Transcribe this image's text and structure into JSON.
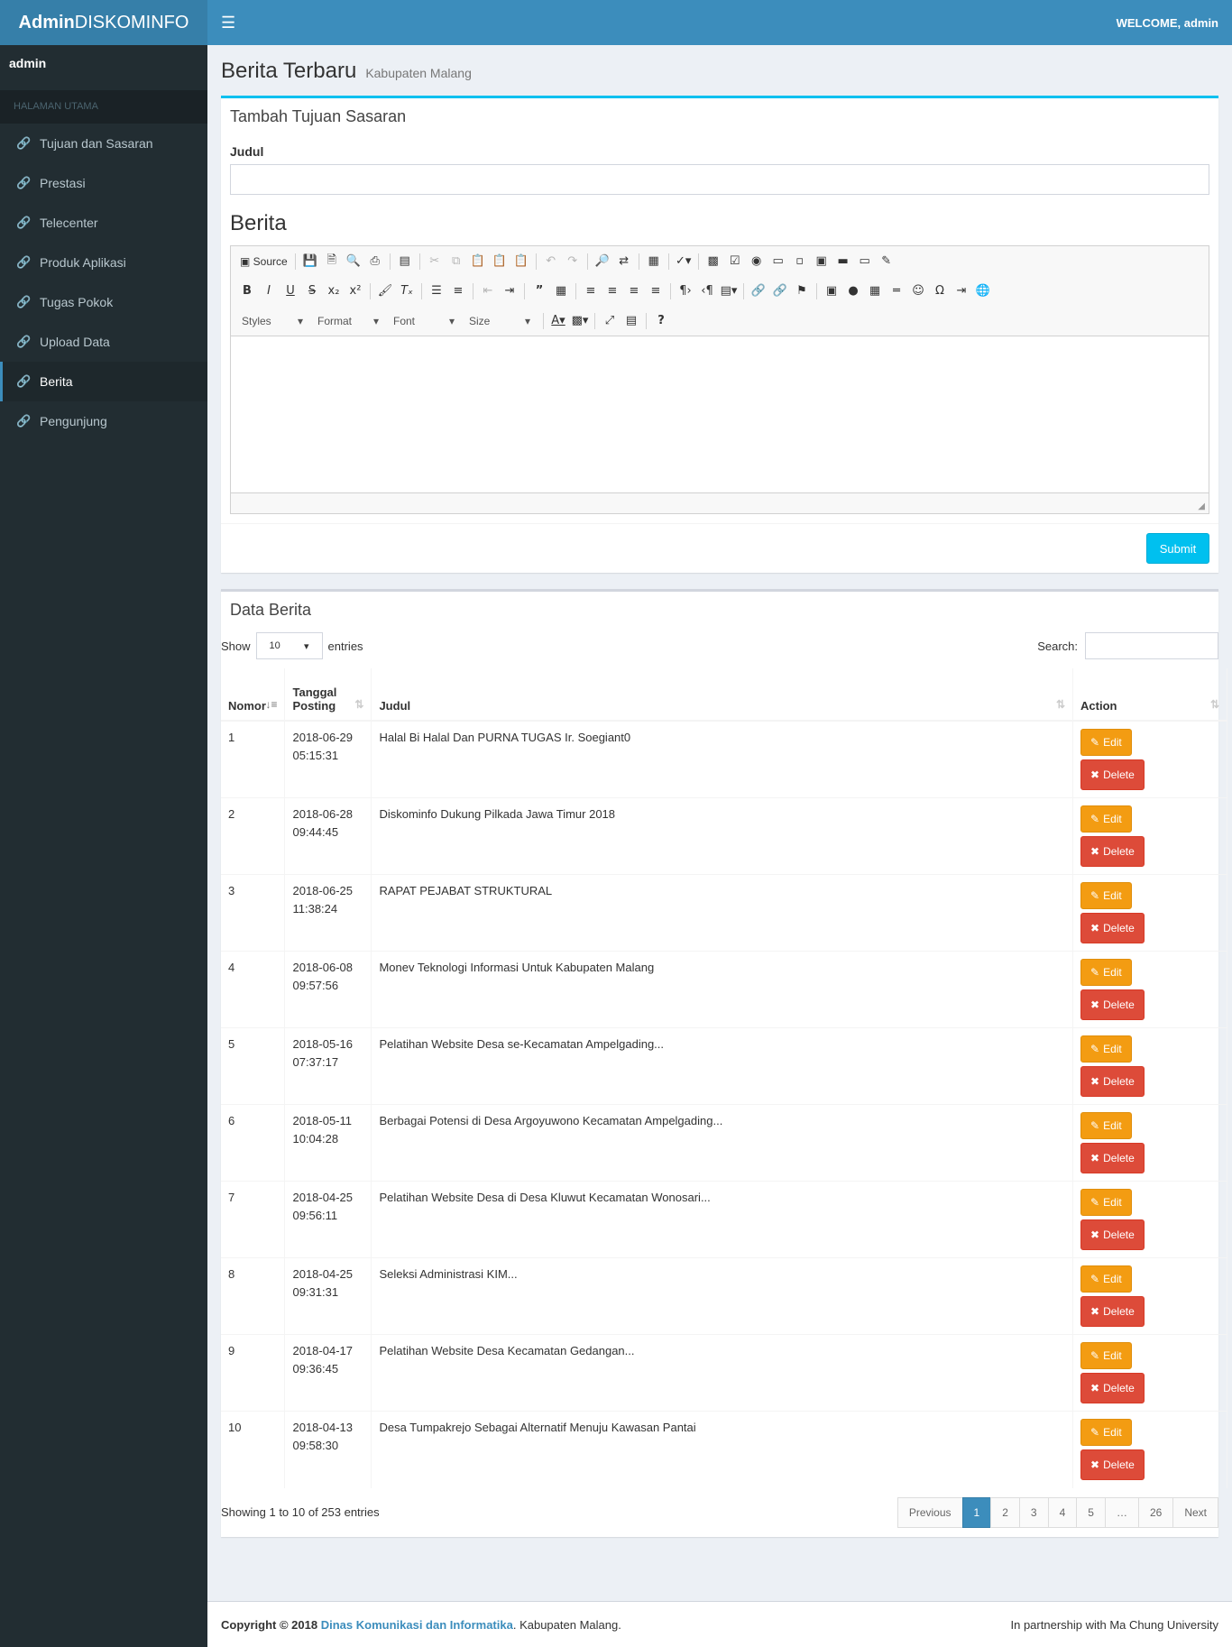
{
  "header": {
    "logo_bold": "Admin",
    "logo_light": "DISKOMINFO",
    "welcome": "WELCOME, admin"
  },
  "sidebar": {
    "user": "admin",
    "section": "HALAMAN UTAMA",
    "items": [
      {
        "label": "Tujuan dan Sasaran",
        "icon": "link-icon",
        "active": false
      },
      {
        "label": "Prestasi",
        "icon": "link-icon",
        "active": false
      },
      {
        "label": "Telecenter",
        "icon": "link-icon",
        "active": false
      },
      {
        "label": "Produk Aplikasi",
        "icon": "link-icon",
        "active": false
      },
      {
        "label": "Tugas Pokok",
        "icon": "link-icon",
        "active": false
      },
      {
        "label": "Upload Data",
        "icon": "link-icon",
        "active": false
      },
      {
        "label": "Berita",
        "icon": "link-icon",
        "active": true
      },
      {
        "label": "Pengunjung",
        "icon": "link-icon",
        "active": false
      }
    ]
  },
  "page": {
    "title": "Berita Terbaru",
    "subtitle": "Kabupaten Malang"
  },
  "form": {
    "box_title": "Tambah Tujuan Sasaran",
    "judul_label": "Judul",
    "judul_value": "",
    "berita_label": "Berita",
    "editor": {
      "source_label": "Source",
      "styles_label": "Styles",
      "format_label": "Format",
      "font_label": "Font",
      "size_label": "Size"
    },
    "submit_label": "Submit"
  },
  "table": {
    "box_title": "Data Berita",
    "show_label": "Show",
    "entries_label": "entries",
    "page_length": "10",
    "search_label": "Search:",
    "columns": [
      "Nomor",
      "Tanggal Posting",
      "Judul",
      "Action"
    ],
    "edit_label": "Edit",
    "delete_label": "Delete",
    "rows": [
      {
        "no": "1",
        "date": "2018-06-29",
        "time": "05:15:31",
        "title": "Halal Bi Halal Dan PURNA TUGAS Ir. Soegiant0"
      },
      {
        "no": "2",
        "date": "2018-06-28",
        "time": "09:44:45",
        "title": "Diskominfo Dukung Pilkada Jawa Timur 2018"
      },
      {
        "no": "3",
        "date": "2018-06-25",
        "time": "11:38:24",
        "title": "RAPAT PEJABAT STRUKTURAL"
      },
      {
        "no": "4",
        "date": "2018-06-08",
        "time": "09:57:56",
        "title": "Monev Teknologi Informasi Untuk Kabupaten Malang"
      },
      {
        "no": "5",
        "date": "2018-05-16",
        "time": "07:37:17",
        "title": "Pelatihan Website Desa se-Kecamatan Ampelgading..."
      },
      {
        "no": "6",
        "date": "2018-05-11",
        "time": "10:04:28",
        "title": "Berbagai Potensi di Desa Argoyuwono Kecamatan Ampelgading..."
      },
      {
        "no": "7",
        "date": "2018-04-25",
        "time": "09:56:11",
        "title": "Pelatihan Website Desa di Desa Kluwut Kecamatan Wonosari..."
      },
      {
        "no": "8",
        "date": "2018-04-25",
        "time": "09:31:31",
        "title": "Seleksi Administrasi KIM..."
      },
      {
        "no": "9",
        "date": "2018-04-17",
        "time": "09:36:45",
        "title": "Pelatihan Website Desa Kecamatan Gedangan..."
      },
      {
        "no": "10",
        "date": "2018-04-13",
        "time": "09:58:30",
        "title": "Desa Tumpakrejo Sebagai Alternatif Menuju Kawasan Pantai"
      }
    ],
    "info": "Showing 1 to 10 of 253 entries",
    "pagination": [
      "Previous",
      "1",
      "2",
      "3",
      "4",
      "5",
      "…",
      "26",
      "Next"
    ],
    "active_page": "1"
  },
  "footer": {
    "copyright_prefix": "Copyright © 2018",
    "org_link": "Dinas Komunikasi dan Informatika",
    "suffix": ". Kabupaten Malang.",
    "partner": "In partnership with Ma Chung University"
  },
  "colors": {
    "header_blue": "#3c8dbc",
    "logo_blue": "#367fa9",
    "sidebar_dark": "#222d32",
    "info_cyan": "#00c0ef",
    "warning_orange": "#f39c12",
    "danger_red": "#dd4b39"
  }
}
